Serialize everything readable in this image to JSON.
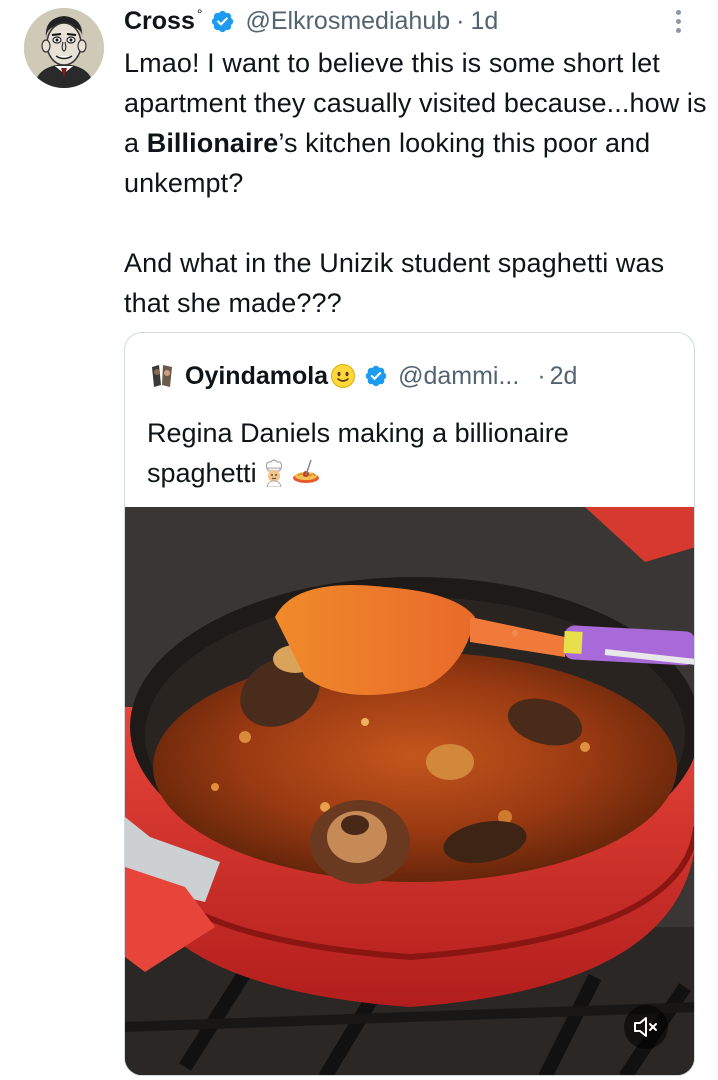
{
  "tweet": {
    "author_name": "Cross",
    "author_suffix": "°",
    "handle": "@Elkrosmediahub",
    "separator": "·",
    "time": "1d",
    "text_line1_a": "Lmao! I want to believe this is some short let apartment they casually visited because...how is a ",
    "text_bold": "Billionaire",
    "text_line1_b": "’s kitchen looking this poor and unkempt?",
    "text_para2": "And what in the Unizik student spaghetti was that she made???"
  },
  "quote": {
    "author_name": "Oyindamola",
    "handle": "@dammi...",
    "separator": "·",
    "time": "2d",
    "text": "Regina Daniels making a billionaire spaghetti"
  },
  "icons": {
    "verified": "verified-badge-icon",
    "more": "more-options-icon",
    "mute": "muted-speaker-icon",
    "face_emoji": "slightly-smiling-face-emoji",
    "chef_emoji": "cook-emoji",
    "spaghetti_emoji": "spaghetti-emoji"
  },
  "colors": {
    "verified_blue": "#1d9bf0",
    "secondary_text": "#536471",
    "quote_border": "#cfd9de"
  }
}
